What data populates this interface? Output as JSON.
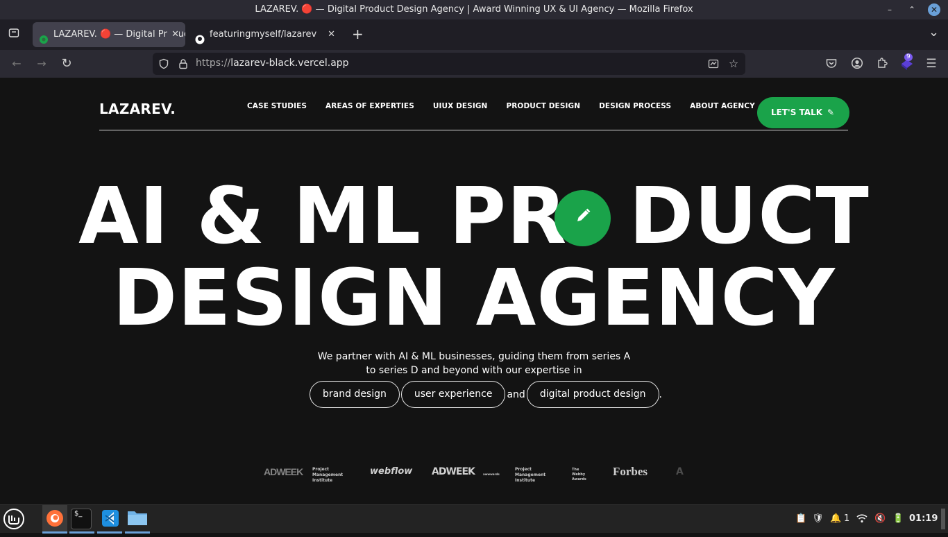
{
  "window": {
    "title": "LAZAREV. 🔴 — Digital Product Design Agency | Award Winning UX & UI Agency — Mozilla Firefox",
    "minimize": "–",
    "maximize": "⌃",
    "close": "✕"
  },
  "tabs": [
    {
      "label": "LAZAREV. 🔴 — Digital Product Design Agency",
      "active": true
    },
    {
      "label": "featuringmyself/lazarev",
      "active": false
    }
  ],
  "tabstrip": {
    "new_tab": "+",
    "list_all": "⌄",
    "close": "✕"
  },
  "toolbar": {
    "back": "←",
    "forward": "→",
    "reload": "↻",
    "url_prefix": "https://",
    "url_host": "lazarev-black.vercel.app",
    "extension_badge": "9"
  },
  "site": {
    "logo": "LAZAREV.",
    "nav": [
      "CASE STUDIES",
      "AREAS OF EXPERTIES",
      "UIUX DESIGN",
      "PRODUCT DESIGN",
      "DESIGN PROCESS",
      "ABOUT AGENCY"
    ],
    "cta": "LET'S TALK",
    "hero_line1_a": "AI & ML PR",
    "hero_line1_b": "DUCT",
    "hero_line2": "DESIGN AGENCY",
    "lead_line1": "We partner with AI & ML businesses, guiding them from series A",
    "lead_line2": "to series D and beyond with our expertise in",
    "pills": {
      "brand": "brand design",
      "ux": "user experience",
      "and": "and",
      "digital": "digital product design",
      "period": "."
    },
    "brands": [
      "ADWEEK",
      "Project Management Institute",
      "webflow",
      "ADWEEK",
      "awwwards",
      "Project Management Institute",
      "The Webby Awards",
      "Forbes",
      "A"
    ]
  },
  "taskbar": {
    "time": "01:19",
    "notifications": "1"
  },
  "colors": {
    "accent_green": "#1aa34a",
    "page_bg": "#131313"
  }
}
